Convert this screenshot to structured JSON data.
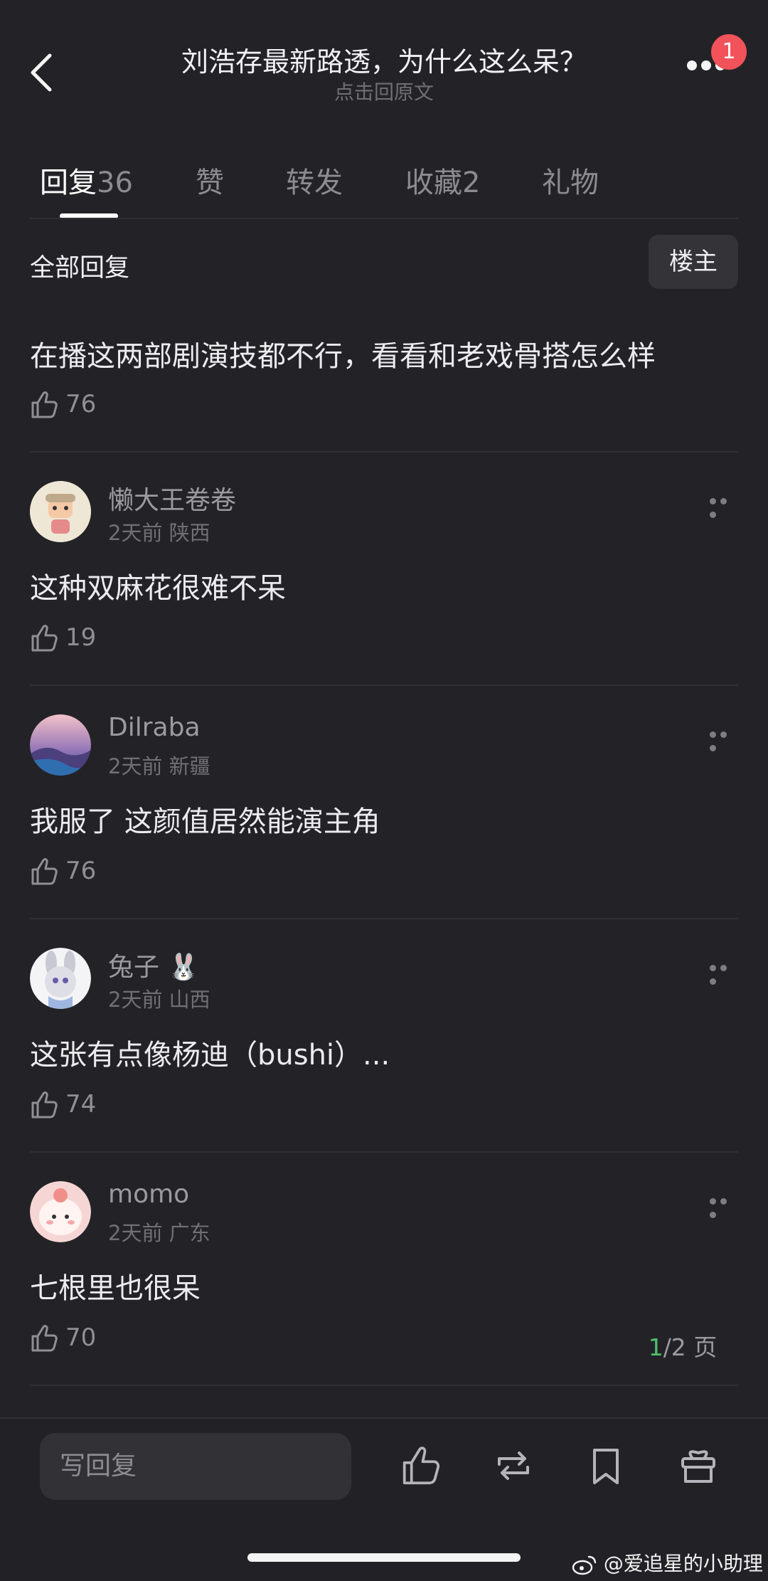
{
  "header": {
    "title": "刘浩存最新路透，为什么这么呆？",
    "subtitle": "点击回原文",
    "notification_count": "1"
  },
  "tabs": [
    {
      "label": "回复",
      "count": "36"
    },
    {
      "label": "赞",
      "count": ""
    },
    {
      "label": "转发",
      "count": ""
    },
    {
      "label": "收藏",
      "count": "2"
    },
    {
      "label": "礼物",
      "count": ""
    }
  ],
  "filter": {
    "all_replies": "全部回复",
    "owner_button": "楼主"
  },
  "comments": [
    {
      "username": "",
      "meta": "",
      "text": "在播这两部剧演技都不行，看看和老戏骨搭怎么样",
      "likes": "76"
    },
    {
      "username": "懒大王卷卷",
      "meta": "2天前 陕西",
      "text": "这种双麻花很难不呆",
      "likes": "19"
    },
    {
      "username": "Dilraba",
      "meta": "2天前 新疆",
      "text": "我服了 这颜值居然能演主角",
      "likes": "76"
    },
    {
      "username": "兔子 🐰",
      "meta": "2天前 山西",
      "text": "这张有点像杨迪（bushi）...",
      "likes": "74"
    },
    {
      "username": "momo",
      "meta": "2天前 广东",
      "text": "七根里也很呆",
      "likes": "70"
    }
  ],
  "pagination": {
    "current": "1",
    "total": "/2 页"
  },
  "bottom_bar": {
    "reply_placeholder": "写回复"
  },
  "watermark": "@爱追星的小助理",
  "colors": {
    "background": "#232327",
    "accent_green": "#4fbf6b",
    "badge_red": "#f2525a"
  }
}
